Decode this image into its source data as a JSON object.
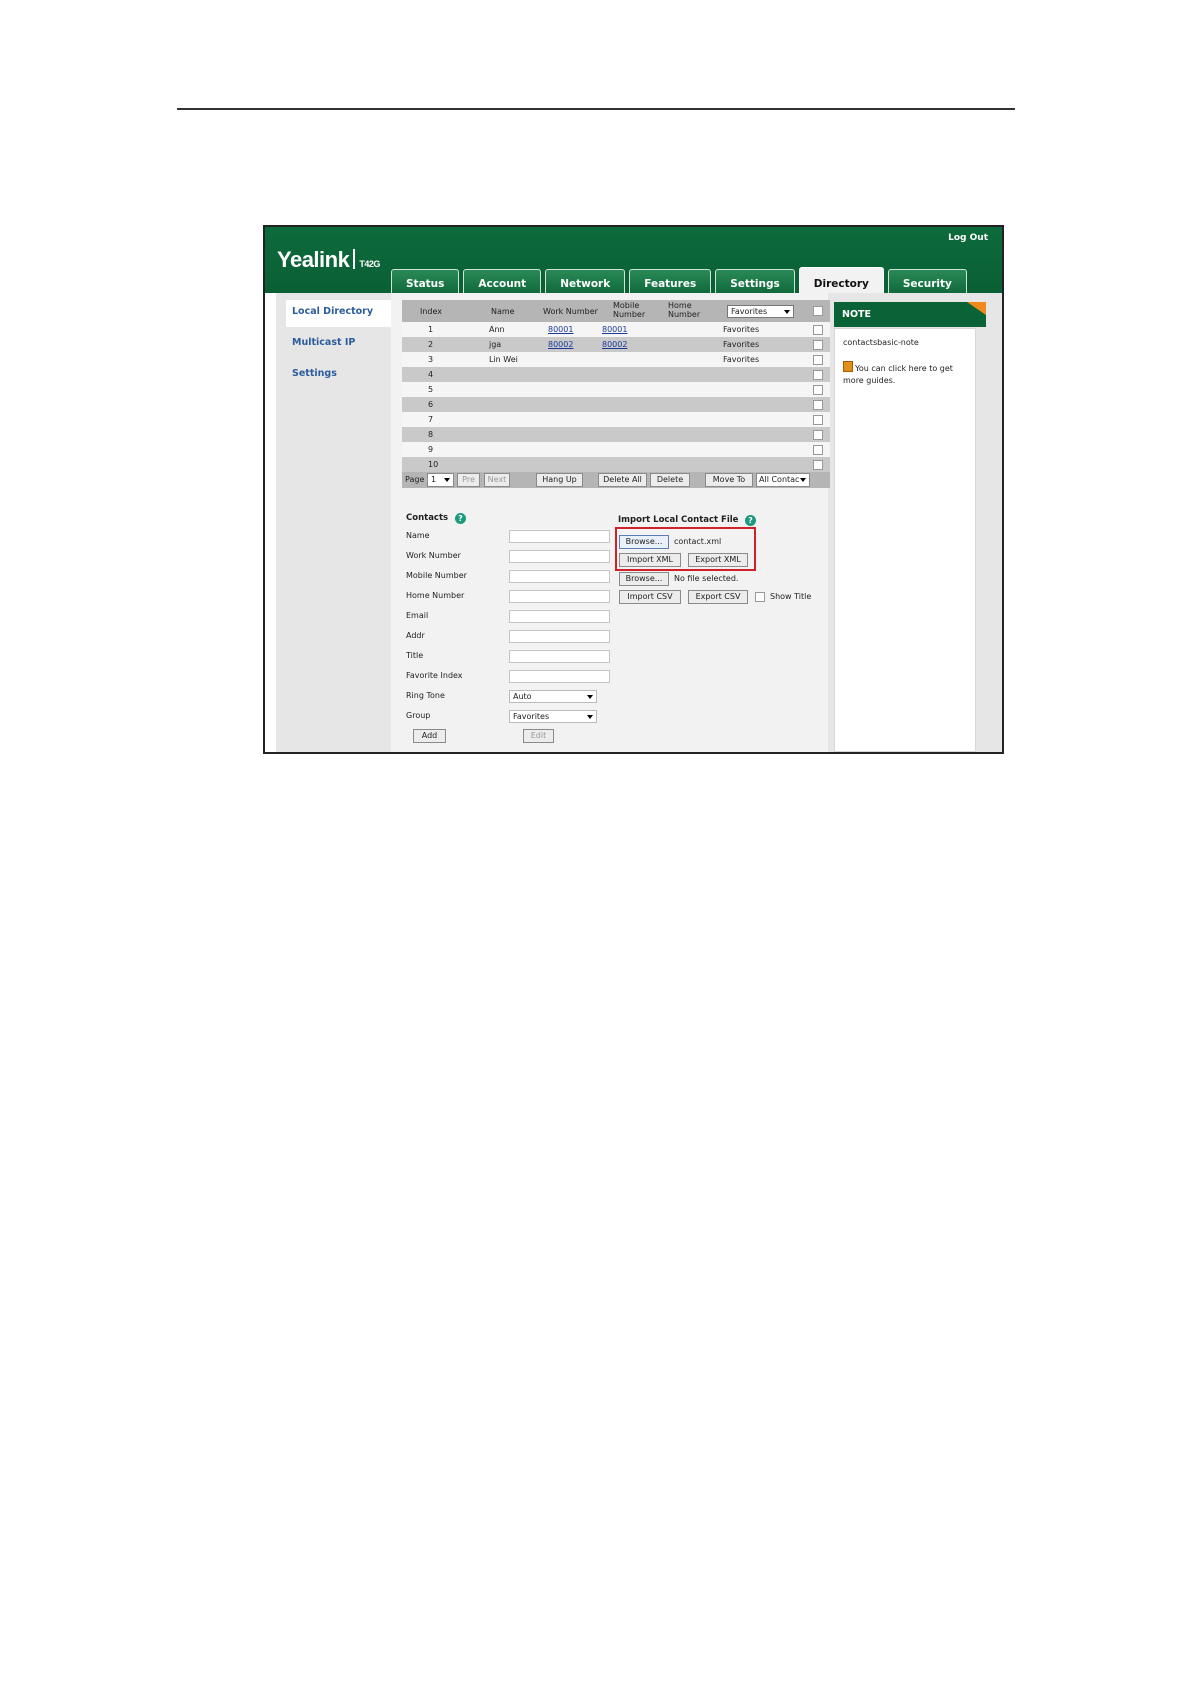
{
  "header": {
    "logo": "Yealink",
    "model": "T42G",
    "logout": "Log Out",
    "tabs": [
      "Status",
      "Account",
      "Network",
      "Features",
      "Settings",
      "Directory",
      "Security"
    ],
    "active_tab": "Directory"
  },
  "sidebar": {
    "items": [
      "Local Directory",
      "Multicast IP",
      "Settings"
    ],
    "active": "Local Directory"
  },
  "table": {
    "headers": {
      "index": "Index",
      "name": "Name",
      "work": "Work Number",
      "mobile": "Mobile Number",
      "home": "Home Number"
    },
    "group_filter": "Favorites",
    "rows": [
      {
        "index": "1",
        "name": "Ann",
        "work": "80001",
        "mobile": "80001",
        "home": "",
        "group": "Favorites"
      },
      {
        "index": "2",
        "name": "jga",
        "work": "80002",
        "mobile": "80002",
        "home": "",
        "group": "Favorites"
      },
      {
        "index": "3",
        "name": "Lin Wei",
        "work": "",
        "mobile": "",
        "home": "",
        "group": "Favorites"
      },
      {
        "index": "4",
        "name": "",
        "work": "",
        "mobile": "",
        "home": "",
        "group": ""
      },
      {
        "index": "5",
        "name": "",
        "work": "",
        "mobile": "",
        "home": "",
        "group": ""
      },
      {
        "index": "6",
        "name": "",
        "work": "",
        "mobile": "",
        "home": "",
        "group": ""
      },
      {
        "index": "7",
        "name": "",
        "work": "",
        "mobile": "",
        "home": "",
        "group": ""
      },
      {
        "index": "8",
        "name": "",
        "work": "",
        "mobile": "",
        "home": "",
        "group": ""
      },
      {
        "index": "9",
        "name": "",
        "work": "",
        "mobile": "",
        "home": "",
        "group": ""
      },
      {
        "index": "10",
        "name": "",
        "work": "",
        "mobile": "",
        "home": "",
        "group": ""
      }
    ],
    "pager": {
      "page_label": "Page",
      "page_value": "1",
      "pre": "Pre",
      "next": "Next",
      "hang_up": "Hang Up",
      "delete_all": "Delete All",
      "delete": "Delete",
      "move_to": "Move To",
      "move_target": "All Contac"
    }
  },
  "contacts": {
    "title": "Contacts",
    "fields": [
      "Name",
      "Work Number",
      "Mobile Number",
      "Home Number",
      "Email",
      "Addr",
      "Title",
      "Favorite Index",
      "Ring Tone",
      "Group"
    ],
    "ring_tone_value": "Auto",
    "group_value": "Favorites",
    "add": "Add",
    "edit": "Edit"
  },
  "import": {
    "title": "Import Local Contact File",
    "browse": "Browse...",
    "xml_file": "contact.xml",
    "import_xml": "Import XML",
    "export_xml": "Export XML",
    "csv_file": "No file selected.",
    "import_csv": "Import CSV",
    "export_csv": "Export CSV",
    "show_title": "Show Title"
  },
  "note": {
    "title": "NOTE",
    "text1": "contactsbasic-note",
    "text2": "You can click here to get more guides."
  },
  "colors": {
    "header_green": "#0c6b3c",
    "link_blue": "#1a3a9a",
    "highlight_red": "#d0202a"
  }
}
